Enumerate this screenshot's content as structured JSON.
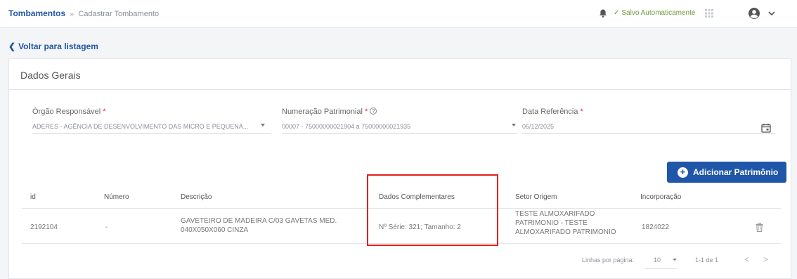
{
  "header": {
    "breadcrumb_root": "Tombamentos",
    "breadcrumb_separator": "»",
    "breadcrumb_current": "Cadastrar Tombamento",
    "saved_status": "Salvo Automaticamente",
    "icons": [
      "bell-icon",
      "check-icon",
      "grid-icon",
      "user-icon",
      "chevron-down-icon"
    ]
  },
  "back_link": "Voltar para listagem",
  "section": {
    "title": "Dados Gerais"
  },
  "form": {
    "orgao": {
      "label": "Órgão Responsável",
      "required": "*",
      "value": "ADERES - AGÊNCIA DE DESENVOLVIMENTO DAS MICRO E PEQUENA..."
    },
    "numeracao": {
      "label": "Numeração Patrimonial",
      "required": "*",
      "help": "?",
      "value": "00007 - 75000000021904 a 75000000021935"
    },
    "data_ref": {
      "label": "Data Referência",
      "required": "*",
      "value": "05/12/2025"
    }
  },
  "add_button": "Adicionar Patrimônio",
  "table": {
    "columns": [
      "id",
      "Número",
      "Descrição",
      "Dados Complementares",
      "Setor Origem",
      "Incorporação"
    ],
    "rows": [
      {
        "id": "2192104",
        "numero": "-",
        "descricao": "GAVETEIRO DE MADEIRA C/03 GAVETAS MED. 040X050X060 CINZA",
        "dados": "Nº Série: 321; Tamanho: 2",
        "setor": "TESTE ALMOXARIFADO PATRIMONIO - TESTE ALMOXARIFADO PATRIMONIO",
        "incorporacao": "1824022"
      }
    ]
  },
  "pagination": {
    "rows_label": "Linhas por página:",
    "rows_value": "10",
    "range": "1-1 de 1",
    "prev": "<",
    "next": ">"
  },
  "colors": {
    "primary": "#1f56a8",
    "saved": "#6c9a3a",
    "required": "#e0245e",
    "highlight": "#e02020"
  }
}
